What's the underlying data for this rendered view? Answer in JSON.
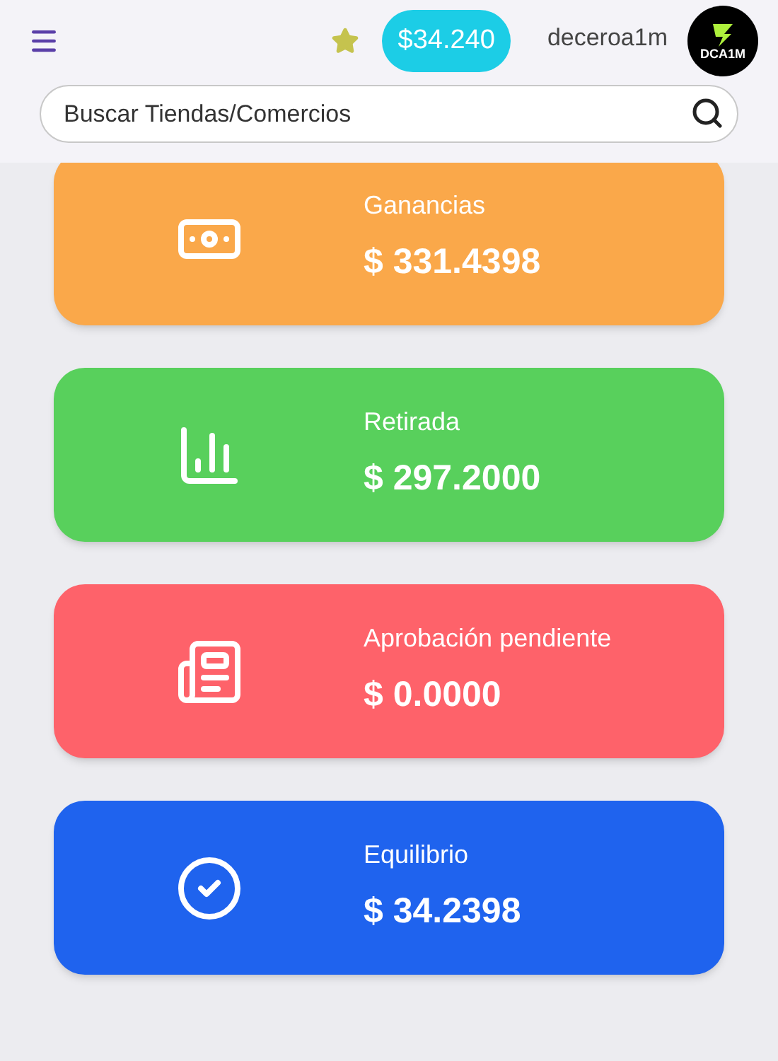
{
  "header": {
    "balance": "$34.240",
    "username": "deceroa1m",
    "logo_text": "DCA1M"
  },
  "search": {
    "placeholder": "Buscar Tiendas/Comercios"
  },
  "cards": [
    {
      "kind": "money",
      "label": "Ganancias",
      "value": "$ 331.4398",
      "color": "#faa84a"
    },
    {
      "kind": "chart",
      "label": "Retirada",
      "value": "$ 297.2000",
      "color": "#58d05c"
    },
    {
      "kind": "news",
      "label": "Aprobación pendiente",
      "value": "$ 0.0000",
      "color": "#fe626a"
    },
    {
      "kind": "check",
      "label": "Equilibrio",
      "value": "$ 34.2398",
      "color": "#1f63ee"
    }
  ]
}
